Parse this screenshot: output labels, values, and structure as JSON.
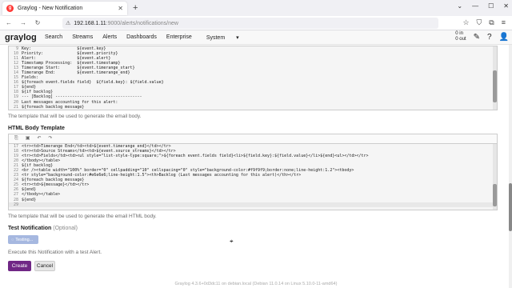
{
  "browser": {
    "tab_title": "Graylog - New Notification",
    "url_host": "192.168.1.11",
    "url_path": ":9000/alerts/notifications/new"
  },
  "nav": {
    "logo_text": "graylog",
    "items": [
      "Search",
      "Streams",
      "Alerts",
      "Dashboards",
      "Enterprise",
      "System"
    ],
    "throughput_in": "0 in",
    "throughput_out": "0 out"
  },
  "email_body": {
    "lines": [
      {
        "n": "9",
        "t": "Key:                   ${event.key}"
      },
      {
        "n": "10",
        "t": "Priority:              ${event.priority}"
      },
      {
        "n": "11",
        "t": "Alert:                 ${event.alert}"
      },
      {
        "n": "12",
        "t": "Timestamp Processing:  ${event.timestamp}"
      },
      {
        "n": "13",
        "t": "Timerange Start:       ${event.timerange_start}"
      },
      {
        "n": "14",
        "t": "Timerange End:         ${event.timerange_end}"
      },
      {
        "n": "15",
        "t": "Fields:"
      },
      {
        "n": "16",
        "t": "${foreach event.fields field}  ${field.key}: ${field.value}"
      },
      {
        "n": "17",
        "t": "${end}"
      },
      {
        "n": "18",
        "t": "${if backlog}"
      },
      {
        "n": "19",
        "t": "--- [Backlog] ------------------------------------"
      },
      {
        "n": "20",
        "t": "Last messages accounting for this alert:"
      },
      {
        "n": "21",
        "t": "${foreach backlog message}"
      }
    ],
    "help": "The template that will be used to generate the email body."
  },
  "html_body": {
    "label": "HTML Body Template",
    "lines": [
      {
        "n": "17",
        "t": "<tr><td>Timerange End</td><td>${event.timerange_end}</td></tr>"
      },
      {
        "n": "18",
        "t": "<tr><td>Source Streams</td><td>${event.source_streams}</td></tr>"
      },
      {
        "n": "19",
        "t": "<tr><td>Fields</td><td><ul style=\"list-style-type:square;\">${foreach event.fields field}<li>${field.key}:${field.value}</li>${end}<ul></td></tr>"
      },
      {
        "n": "20",
        "t": "</tbody></table>"
      },
      {
        "n": "21",
        "t": "${if backlog}"
      },
      {
        "n": "22",
        "t": "<br /><table width=\"100%\" border=\"0\" cellpadding=\"10\" cellspacing=\"0\" style=\"background-color:#f9f9f9;border:none;line-height:1.2\"><tbody>"
      },
      {
        "n": "23",
        "t": "<tr style=\"background-color:#e6e6e6;line-height:1.5\"><th>Backlog (Last messages accounting for this alert)</th></tr>"
      },
      {
        "n": "24",
        "t": "${foreach backlog message}"
      },
      {
        "n": "25",
        "t": "<tr><td>${message}</td></tr>"
      },
      {
        "n": "26",
        "t": "${end}"
      },
      {
        "n": "27",
        "t": "</tbody></table>"
      },
      {
        "n": "28",
        "t": "${end}"
      },
      {
        "n": "29",
        "t": ""
      }
    ],
    "help": "The template that will be used to generate the email HTML body."
  },
  "test": {
    "label": "Test Notification",
    "optional": "(Optional)",
    "button": "Testing...",
    "help": "Execute this Notification with a test Alert."
  },
  "actions": {
    "create": "Create",
    "cancel": "Cancel"
  },
  "footer": "Graylog 4.3.6+0d3dc11 on debian.local (Debian 11.0.14 on Linux 5.10.0-11-amd64)",
  "colors": {
    "brand": "#ff3633",
    "primary": "#702785",
    "test_button": "#a6b8e0"
  }
}
